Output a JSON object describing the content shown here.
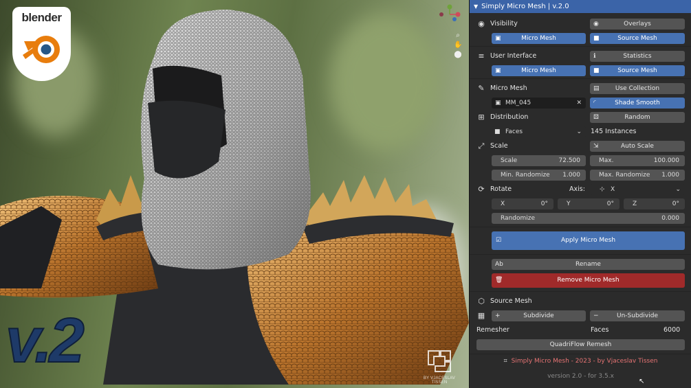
{
  "viewport": {
    "logo": {
      "word": "blender"
    },
    "version_overlay": "v.2",
    "watermark": "BY VJACESLAV TISSEN",
    "gizmo": {
      "x": "X",
      "y": "Y",
      "z": "Z"
    }
  },
  "panel": {
    "title": "Simply Micro Mesh | v.2.0",
    "visibility": {
      "label": "Visibility",
      "overlays": "Overlays",
      "micro_mesh": "Micro Mesh",
      "source_mesh": "Source Mesh"
    },
    "user_interface": {
      "label": "User Interface",
      "statistics": "Statistics",
      "micro_mesh": "Micro Mesh",
      "source_mesh": "Source Mesh"
    },
    "micro_mesh": {
      "label": "Micro Mesh",
      "use_collection": "Use Collection",
      "object_name": "MM_045",
      "shade_smooth": "Shade Smooth"
    },
    "distribution": {
      "label": "Distribution",
      "random": "Random",
      "mode": "Faces",
      "instances": "145 Instances"
    },
    "scale": {
      "label": "Scale",
      "auto_scale": "Auto Scale",
      "scale_label": "Scale",
      "scale_value": "72.500",
      "max_label": "Max.",
      "max_value": "100.000",
      "min_rand_label": "Min. Randomize",
      "min_rand_value": "1.000",
      "max_rand_label": "Max. Randomize",
      "max_rand_value": "1.000"
    },
    "rotate": {
      "label": "Rotate",
      "axis_label": "Axis:",
      "axis_value": "X",
      "x_label": "X",
      "x_value": "0°",
      "y_label": "Y",
      "y_value": "0°",
      "z_label": "Z",
      "z_value": "0°",
      "randomize_label": "Randomize",
      "randomize_value": "0.000"
    },
    "actions": {
      "apply": "Apply Micro Mesh",
      "rename": "Rename",
      "remove": "Remove Micro Mesh"
    },
    "source_mesh": {
      "label": "Source Mesh",
      "subdivide": "Subdivide",
      "un_subdivide": "Un-Subdivide",
      "remesher_label": "Remesher",
      "faces_label": "Faces",
      "faces_value": "6000",
      "quadriflow": "QuadriFlow Remesh"
    },
    "footer": {
      "credit": "Simply Micro Mesh - 2023 - by Vjaceslav Tissen",
      "version": "version 2.0 - for 3.5.x"
    }
  },
  "colors": {
    "accent_blue": "#4772b3",
    "danger_red": "#a02a2a",
    "header_blue": "#3b64a8",
    "credit_red": "#e57373"
  }
}
